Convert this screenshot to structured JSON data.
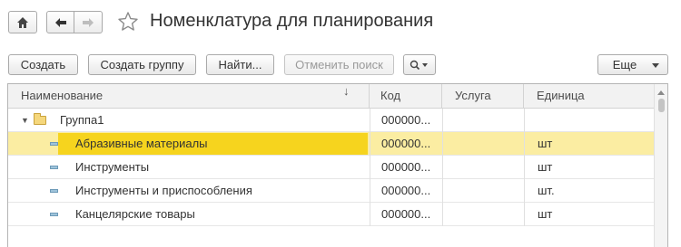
{
  "header": {
    "title": "Номенклатура для планирования",
    "home_icon": "home-icon",
    "back_icon": "arrow-left-icon",
    "forward_icon": "arrow-right-icon",
    "favorite_icon": "star-icon"
  },
  "toolbar": {
    "create_label": "Создать",
    "create_group_label": "Создать группу",
    "find_label": "Найти...",
    "cancel_search_label": "Отменить поиск",
    "search_icon": "search-icon",
    "more_label": "Еще"
  },
  "table": {
    "columns": [
      "Наименование",
      "Код",
      "Услуга",
      "Единица"
    ],
    "sort_indicator": "↓",
    "rows": [
      {
        "name": "Группа1",
        "code": "000000...",
        "service": "",
        "unit": "",
        "type": "group"
      },
      {
        "name": "Абразивные материалы",
        "code": "000000...",
        "service": "",
        "unit": "шт",
        "type": "item",
        "selected": true
      },
      {
        "name": "Инструменты",
        "code": "000000...",
        "service": "",
        "unit": "шт",
        "type": "item"
      },
      {
        "name": "Инструменты и приспособления",
        "code": "000000...",
        "service": "",
        "unit": "шт.",
        "type": "item"
      },
      {
        "name": "Канцелярские товары",
        "code": "000000...",
        "service": "",
        "unit": "шт",
        "type": "item"
      }
    ]
  },
  "colors": {
    "selected_row": "#fbeda2",
    "selected_cell": "#f6d41e"
  }
}
